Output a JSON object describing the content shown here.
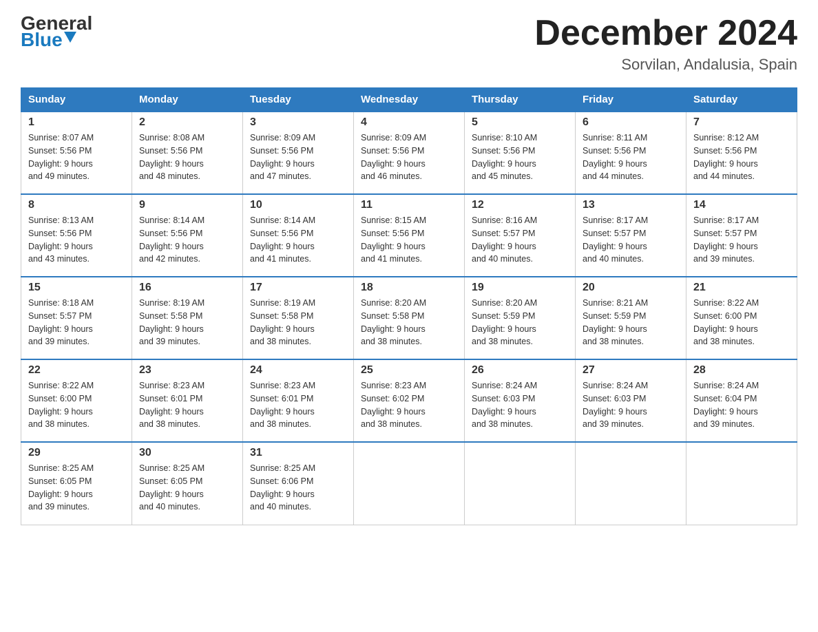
{
  "logo": {
    "general": "General",
    "blue": "Blue",
    "arrow": "▼"
  },
  "title": "December 2024",
  "location": "Sorvilan, Andalusia, Spain",
  "days_of_week": [
    "Sunday",
    "Monday",
    "Tuesday",
    "Wednesday",
    "Thursday",
    "Friday",
    "Saturday"
  ],
  "weeks": [
    [
      {
        "num": "1",
        "sunrise": "8:07 AM",
        "sunset": "5:56 PM",
        "daylight": "9 hours and 49 minutes."
      },
      {
        "num": "2",
        "sunrise": "8:08 AM",
        "sunset": "5:56 PM",
        "daylight": "9 hours and 48 minutes."
      },
      {
        "num": "3",
        "sunrise": "8:09 AM",
        "sunset": "5:56 PM",
        "daylight": "9 hours and 47 minutes."
      },
      {
        "num": "4",
        "sunrise": "8:09 AM",
        "sunset": "5:56 PM",
        "daylight": "9 hours and 46 minutes."
      },
      {
        "num": "5",
        "sunrise": "8:10 AM",
        "sunset": "5:56 PM",
        "daylight": "9 hours and 45 minutes."
      },
      {
        "num": "6",
        "sunrise": "8:11 AM",
        "sunset": "5:56 PM",
        "daylight": "9 hours and 44 minutes."
      },
      {
        "num": "7",
        "sunrise": "8:12 AM",
        "sunset": "5:56 PM",
        "daylight": "9 hours and 44 minutes."
      }
    ],
    [
      {
        "num": "8",
        "sunrise": "8:13 AM",
        "sunset": "5:56 PM",
        "daylight": "9 hours and 43 minutes."
      },
      {
        "num": "9",
        "sunrise": "8:14 AM",
        "sunset": "5:56 PM",
        "daylight": "9 hours and 42 minutes."
      },
      {
        "num": "10",
        "sunrise": "8:14 AM",
        "sunset": "5:56 PM",
        "daylight": "9 hours and 41 minutes."
      },
      {
        "num": "11",
        "sunrise": "8:15 AM",
        "sunset": "5:56 PM",
        "daylight": "9 hours and 41 minutes."
      },
      {
        "num": "12",
        "sunrise": "8:16 AM",
        "sunset": "5:57 PM",
        "daylight": "9 hours and 40 minutes."
      },
      {
        "num": "13",
        "sunrise": "8:17 AM",
        "sunset": "5:57 PM",
        "daylight": "9 hours and 40 minutes."
      },
      {
        "num": "14",
        "sunrise": "8:17 AM",
        "sunset": "5:57 PM",
        "daylight": "9 hours and 39 minutes."
      }
    ],
    [
      {
        "num": "15",
        "sunrise": "8:18 AM",
        "sunset": "5:57 PM",
        "daylight": "9 hours and 39 minutes."
      },
      {
        "num": "16",
        "sunrise": "8:19 AM",
        "sunset": "5:58 PM",
        "daylight": "9 hours and 39 minutes."
      },
      {
        "num": "17",
        "sunrise": "8:19 AM",
        "sunset": "5:58 PM",
        "daylight": "9 hours and 38 minutes."
      },
      {
        "num": "18",
        "sunrise": "8:20 AM",
        "sunset": "5:58 PM",
        "daylight": "9 hours and 38 minutes."
      },
      {
        "num": "19",
        "sunrise": "8:20 AM",
        "sunset": "5:59 PM",
        "daylight": "9 hours and 38 minutes."
      },
      {
        "num": "20",
        "sunrise": "8:21 AM",
        "sunset": "5:59 PM",
        "daylight": "9 hours and 38 minutes."
      },
      {
        "num": "21",
        "sunrise": "8:22 AM",
        "sunset": "6:00 PM",
        "daylight": "9 hours and 38 minutes."
      }
    ],
    [
      {
        "num": "22",
        "sunrise": "8:22 AM",
        "sunset": "6:00 PM",
        "daylight": "9 hours and 38 minutes."
      },
      {
        "num": "23",
        "sunrise": "8:23 AM",
        "sunset": "6:01 PM",
        "daylight": "9 hours and 38 minutes."
      },
      {
        "num": "24",
        "sunrise": "8:23 AM",
        "sunset": "6:01 PM",
        "daylight": "9 hours and 38 minutes."
      },
      {
        "num": "25",
        "sunrise": "8:23 AM",
        "sunset": "6:02 PM",
        "daylight": "9 hours and 38 minutes."
      },
      {
        "num": "26",
        "sunrise": "8:24 AM",
        "sunset": "6:03 PM",
        "daylight": "9 hours and 38 minutes."
      },
      {
        "num": "27",
        "sunrise": "8:24 AM",
        "sunset": "6:03 PM",
        "daylight": "9 hours and 39 minutes."
      },
      {
        "num": "28",
        "sunrise": "8:24 AM",
        "sunset": "6:04 PM",
        "daylight": "9 hours and 39 minutes."
      }
    ],
    [
      {
        "num": "29",
        "sunrise": "8:25 AM",
        "sunset": "6:05 PM",
        "daylight": "9 hours and 39 minutes."
      },
      {
        "num": "30",
        "sunrise": "8:25 AM",
        "sunset": "6:05 PM",
        "daylight": "9 hours and 40 minutes."
      },
      {
        "num": "31",
        "sunrise": "8:25 AM",
        "sunset": "6:06 PM",
        "daylight": "9 hours and 40 minutes."
      },
      null,
      null,
      null,
      null
    ]
  ],
  "labels": {
    "sunrise": "Sunrise:",
    "sunset": "Sunset:",
    "daylight": "Daylight:"
  }
}
